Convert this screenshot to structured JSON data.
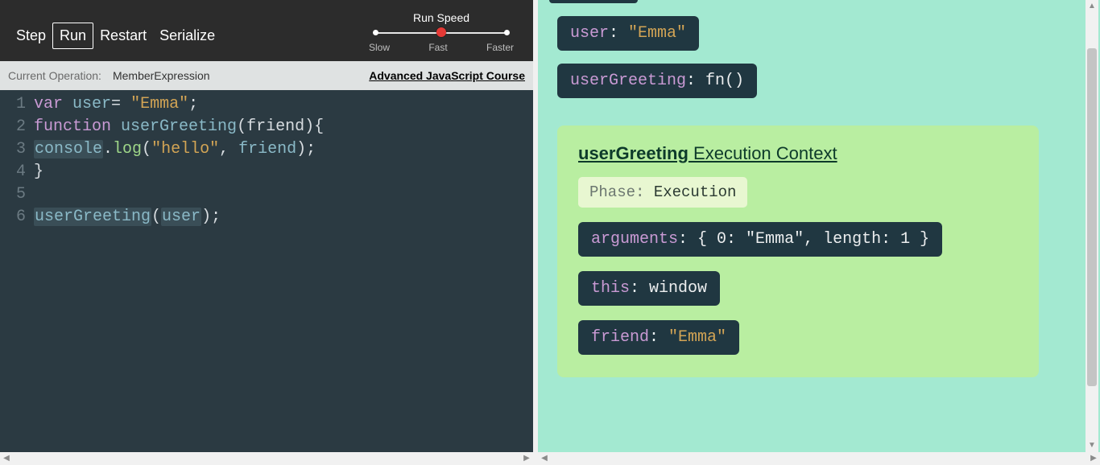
{
  "toolbar": {
    "step": "Step",
    "run": "Run",
    "restart": "Restart",
    "serialize": "Serialize"
  },
  "speed": {
    "title": "Run Speed",
    "slow": "Slow",
    "fast": "Fast",
    "faster": "Faster"
  },
  "opbar": {
    "label": "Current Operation:",
    "value": "MemberExpression",
    "course": "Advanced JavaScript Course"
  },
  "code": {
    "lines": [
      "1",
      "2",
      "3",
      "4",
      "5",
      "6"
    ],
    "l1": {
      "kw": "var",
      "id": "user",
      "eq": "= ",
      "str": "\"Emma\"",
      "end": ";"
    },
    "l2": {
      "kw": "function",
      "id": "userGreeting",
      "args": "(friend){"
    },
    "l3": {
      "obj": "console",
      "dot": ".",
      "method": "log",
      "open": "(",
      "s1": "\"hello\"",
      "comma": ", ",
      "arg": "friend",
      "close": ");"
    },
    "l4": {
      "brace": "}"
    },
    "l6": {
      "fn": "userGreeting",
      "open": "(",
      "arg": "user",
      "close": ");"
    }
  },
  "globals": {
    "user": {
      "key": "user",
      "sep": ": ",
      "value": "\"Emma\""
    },
    "userGreeting": {
      "key": "userGreeting",
      "sep": ": ",
      "value": "fn()"
    }
  },
  "context": {
    "title_fn": "userGreeting",
    "title_suffix": " Execution Context",
    "phase_label": "Phase: ",
    "phase_value": "Execution",
    "arguments": {
      "key": "arguments",
      "sep": ": ",
      "value": "{ 0: \"Emma\", length: 1 }"
    },
    "this": {
      "key": "this",
      "sep": ": ",
      "value": "window"
    },
    "friend": {
      "key": "friend",
      "sep": ": ",
      "value": "\"Emma\""
    }
  }
}
